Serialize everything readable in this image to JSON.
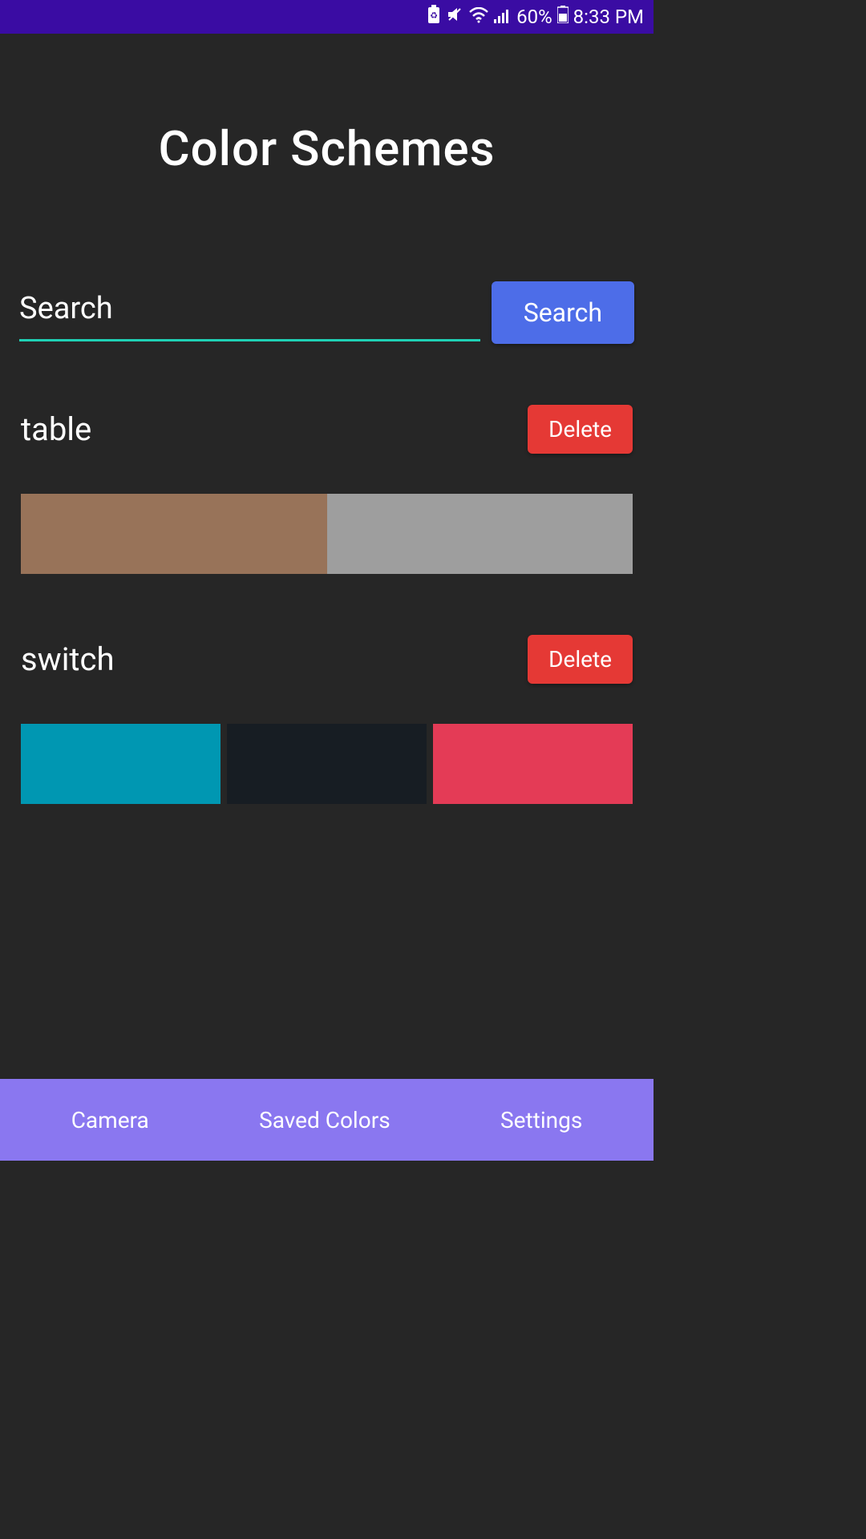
{
  "status_bar": {
    "battery_pct": "60%",
    "time": "8:33 PM"
  },
  "title": "Color Schemes",
  "search": {
    "placeholder": "Search",
    "button_label": "Search"
  },
  "schemes": [
    {
      "name": "table",
      "delete_label": "Delete",
      "colors": [
        "#987359",
        "#9e9e9e"
      ]
    },
    {
      "name": "switch",
      "delete_label": "Delete",
      "colors": [
        "#0097b2",
        "#171d23",
        "#e43b56"
      ]
    }
  ],
  "nav": {
    "camera": "Camera",
    "saved": "Saved Colors",
    "settings": "Settings"
  }
}
